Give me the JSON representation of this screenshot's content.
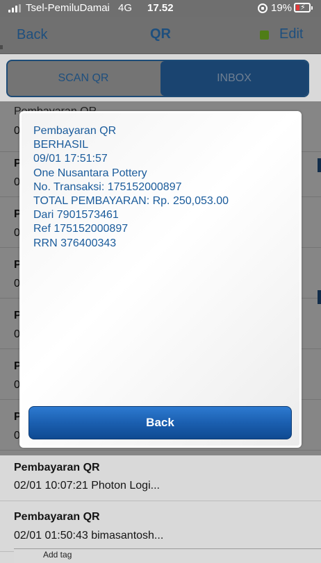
{
  "status_bar": {
    "carrier": "Tsel-PemiluDamai",
    "network": "4G",
    "time": "17.52",
    "battery": "19%"
  },
  "nav": {
    "back_label": "Back",
    "title": "QR",
    "edit_label": "Edit"
  },
  "tabs": [
    {
      "label": "SCAN QR",
      "active": false
    },
    {
      "label": "INBOX",
      "active": true
    }
  ],
  "list": {
    "items": [
      {
        "title": "Pembayaran QR",
        "subtitle": "0"
      },
      {
        "title": "P",
        "subtitle": "0"
      },
      {
        "title": "P",
        "subtitle": "0"
      },
      {
        "title": "P",
        "subtitle": "0"
      },
      {
        "title": "P",
        "subtitle": "0"
      },
      {
        "title": "P",
        "subtitle": "0"
      },
      {
        "title": "P",
        "subtitle": "0"
      },
      {
        "title": "Pembayaran QR",
        "subtitle": "02/01 10:07:21 Photon Logi..."
      },
      {
        "title": "Pembayaran QR",
        "subtitle": "02/01 01:50:43 bimasantosh..."
      }
    ],
    "footer_tag": "Add tag"
  },
  "modal": {
    "lines": [
      "Pembayaran QR",
      "BERHASIL",
      "09/01 17:51:57",
      "One Nusantara Pottery",
      "No. Transaksi: 175152000897",
      "TOTAL PEMBAYARAN: Rp. 250,053.00",
      "Dari 7901573461",
      "Ref 175152000897",
      "RRN 376400343"
    ],
    "button_label": "Back"
  },
  "colors": {
    "accent": "#1e4f7e",
    "message_text": "#1a5b9b",
    "button": "#1b5fb0"
  }
}
